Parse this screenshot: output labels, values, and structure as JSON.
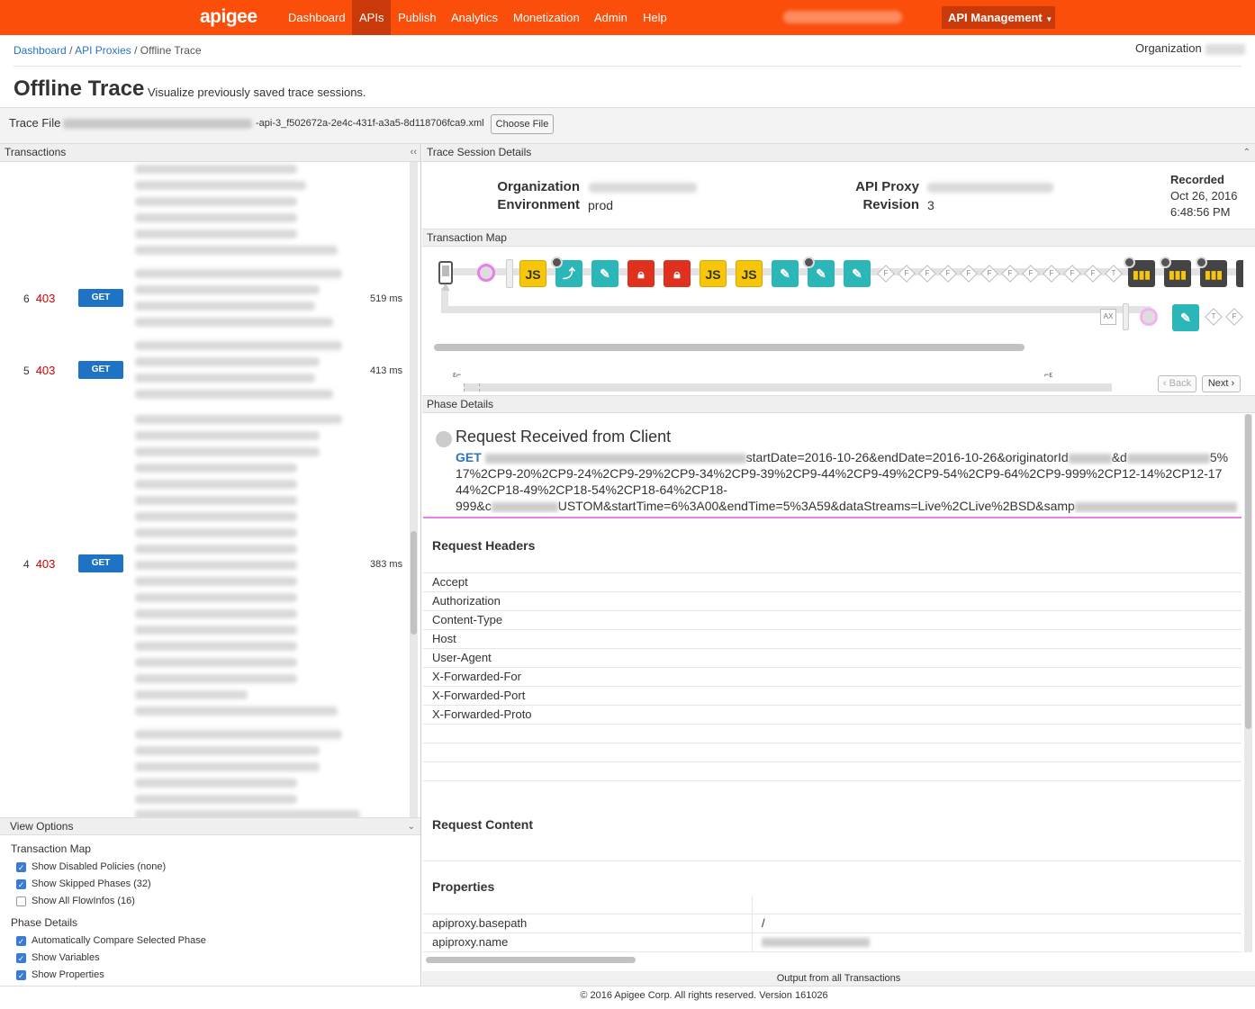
{
  "nav": {
    "logo": "apigee",
    "items": [
      "Dashboard",
      "APIs",
      "Publish",
      "Analytics",
      "Monetization",
      "Admin",
      "Help"
    ],
    "active": "APIs",
    "api_management": "API Management"
  },
  "breadcrumb": [
    "Dashboard",
    "API Proxies",
    "Offline Trace"
  ],
  "organization_label": "Organization",
  "page": {
    "title": "Offline Trace",
    "subtitle": "Visualize previously saved trace sessions."
  },
  "trace_file": {
    "label": "Trace File",
    "filename_visible": "-api-3_f502672a-2e4c-431f-a3a5-8d118706fca9.xml",
    "choose_button": "Choose File"
  },
  "transactions": {
    "header": "Transactions",
    "collapse_icon": "double-chevron-left-icon",
    "rows": [
      {
        "index": "6",
        "status": "403",
        "method": "GET",
        "duration": "519 ms"
      },
      {
        "index": "5",
        "status": "403",
        "method": "GET",
        "duration": "413 ms"
      },
      {
        "index": "4",
        "status": "403",
        "method": "GET",
        "duration": "383 ms"
      }
    ]
  },
  "view_options": {
    "header": "View Options",
    "transaction_map_label": "Transaction Map",
    "transaction_map_options": [
      {
        "label": "Show Disabled Policies (none)",
        "checked": true
      },
      {
        "label": "Show Skipped Phases (32)",
        "checked": true
      },
      {
        "label": "Show All FlowInfos (16)",
        "checked": false
      }
    ],
    "phase_details_label": "Phase Details",
    "phase_details_options": [
      {
        "label": "Automatically Compare Selected Phase",
        "checked": true
      },
      {
        "label": "Show Variables",
        "checked": true
      },
      {
        "label": "Show Properties",
        "checked": true
      }
    ]
  },
  "session": {
    "header": "Trace Session Details",
    "organization_label": "Organization",
    "environment_label": "Environment",
    "environment": "prod",
    "api_proxy_label": "API Proxy",
    "revision_label": "Revision",
    "revision": "3",
    "recorded_label": "Recorded",
    "recorded_date": "Oct 26, 2016",
    "recorded_time": "6:48:56 PM"
  },
  "transaction_map": {
    "header": "Transaction Map",
    "js_label": "JS",
    "diamond_flags": [
      "F",
      "F",
      "F",
      "F",
      "F",
      "F",
      "F",
      "F",
      "F",
      "F",
      "F",
      "F",
      "T"
    ],
    "return_labels": [
      "AX",
      "T",
      "F"
    ],
    "epsilon_left": "ε",
    "epsilon_right": "ε",
    "back": "Back",
    "next": "Next"
  },
  "phase": {
    "header": "Phase Details",
    "title": "Request Received from Client",
    "method": "GET",
    "line1_tail": "startDate=2016-10-26&endDate=2016-10-26&originatorId",
    "line1_amp": "&d",
    "line1_end": "5%",
    "line2": "17%2CP9-20%2CP9-24%2CP9-29%2CP9-34%2CP9-39%2CP9-44%2CP9-49%2CP9-54%2CP9-64%2CP9-999%2CP12-14%2CP12-17",
    "line3": "44%2CP18-49%2CP18-54%2CP18-64%2CP18-",
    "line4_start": "999&c",
    "line4_mid": "USTOM&startTime=6%3A00&endTime=5%3A59&dataStreams=Live%2CLive%2BSD&samp"
  },
  "request_headers": {
    "title": "Request Headers",
    "names": [
      "Accept",
      "Authorization",
      "Content-Type",
      "Host",
      "User-Agent",
      "X-Forwarded-For",
      "X-Forwarded-Port",
      "X-Forwarded-Proto"
    ]
  },
  "request_content": {
    "title": "Request Content"
  },
  "properties": {
    "title": "Properties",
    "rows": [
      {
        "name": "apiproxy.basepath",
        "value": "/"
      },
      {
        "name": "apiproxy.name",
        "value": ""
      }
    ]
  },
  "footer": {
    "output": "Output from all Transactions",
    "copyright": "© 2016 Apigee Corp. All rights reserved. Version 161026"
  },
  "colors": {
    "topbar": "#fb4e0b",
    "active_nav": "#c9390a",
    "link": "#2a73c5",
    "status_error": "#cc0000",
    "get_button": "#1e73c4",
    "policy_teal": "#2bb7b7",
    "policy_js": "#f7c609",
    "policy_red": "#e0301e",
    "phase_marker": "#e87ee8"
  }
}
